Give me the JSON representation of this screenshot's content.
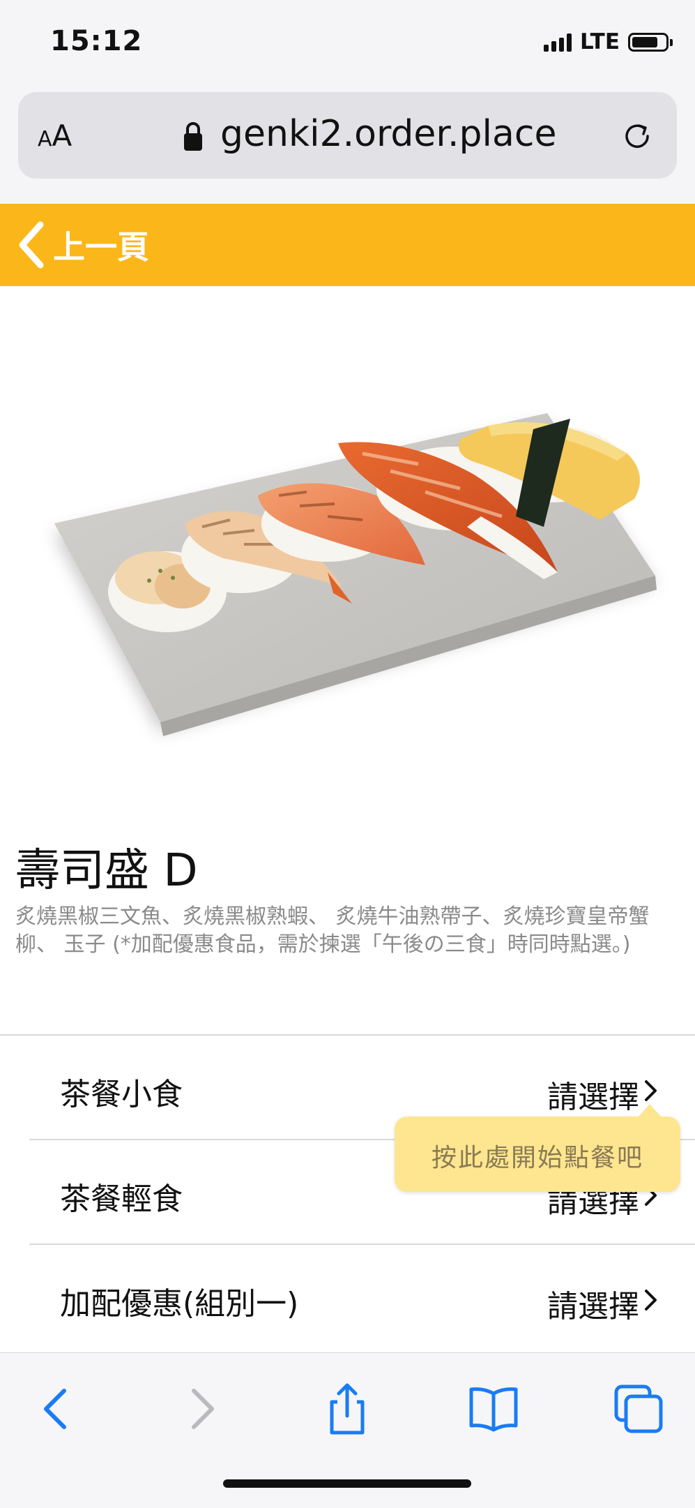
{
  "status_bar": {
    "time": "15:12",
    "network": "LTE",
    "battery_level": 0.78
  },
  "browser": {
    "text_size_label_small": "A",
    "text_size_label_large": "A",
    "url": "genki2.order.place"
  },
  "header": {
    "back_label": "上一頁"
  },
  "product": {
    "title": "壽司盛 D",
    "description": "炙燒黑椒三文魚、炙燒黑椒熟蝦、 炙燒牛油熟帶子、炙燒珍寶皇帝蟹柳、 玉子 (*加配優惠食品，需於揀選「午後の三食」時同時點選。)"
  },
  "options": [
    {
      "label": "茶餐小食",
      "action": "請選擇"
    },
    {
      "label": "茶餐輕食",
      "action": "請選擇"
    },
    {
      "label": "加配優惠(組別一)",
      "action": "請選擇"
    }
  ],
  "tooltip": {
    "text": "按此處開始點餐吧"
  },
  "colors": {
    "brand": "#fbb619",
    "tooltip_bg": "#fde68f",
    "link_blue": "#1a7cf5"
  },
  "toolbar": {
    "icons": [
      "back-icon",
      "forward-icon",
      "share-icon",
      "bookmarks-icon",
      "tabs-icon"
    ]
  }
}
